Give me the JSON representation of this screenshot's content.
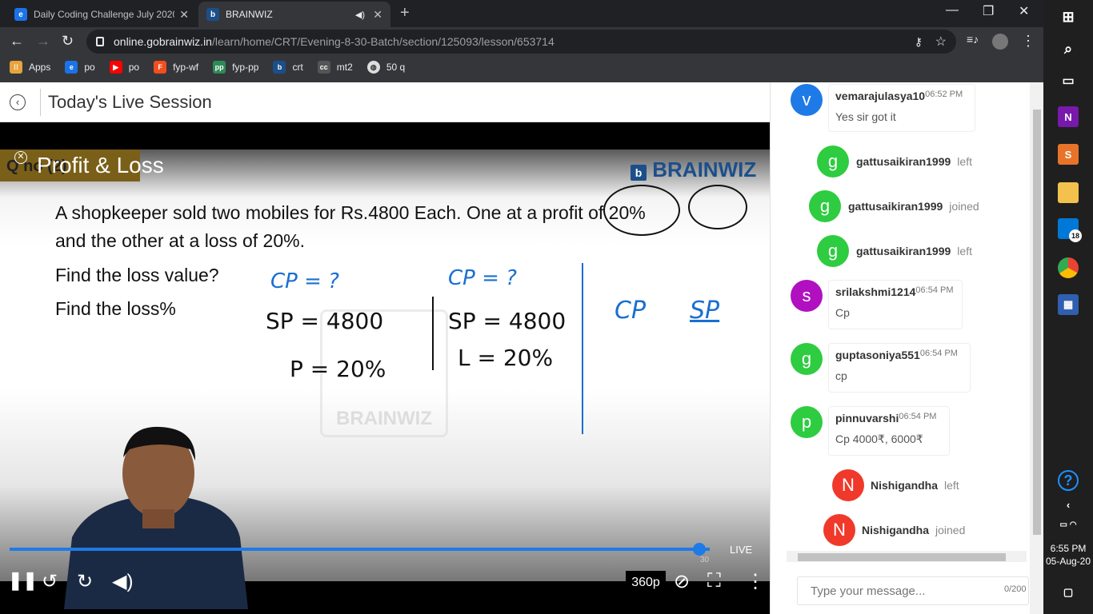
{
  "browser": {
    "tabs": [
      {
        "title": "Daily Coding Challenge July 2020",
        "favicon_color": "#1a73e8"
      },
      {
        "title": "BRAINWIZ",
        "favicon_color": "#1c4f8a"
      }
    ],
    "url_host": "online.gobrainwiz.in",
    "url_path": "/learn/home/CRT/Evening-8-30-Batch/section/125093/lesson/653714",
    "bookmarks": [
      {
        "label": "Apps",
        "icon": "apps-grid-icon",
        "color": "#e8a33d"
      },
      {
        "label": "po",
        "icon": "edge-icon",
        "color": "#1a73e8"
      },
      {
        "label": "po",
        "icon": "youtube-icon",
        "color": "#ff0000"
      },
      {
        "label": "fyp-wf",
        "icon": "figma-icon",
        "color": "#f24e1e"
      },
      {
        "label": "fyp-pp",
        "icon": "pp-icon",
        "color": "#2e8b57"
      },
      {
        "label": "crt",
        "icon": "brainwiz-icon",
        "color": "#1c4f8a"
      },
      {
        "label": "mt2",
        "icon": "cc-icon",
        "color": "#555555"
      },
      {
        "label": "50 q",
        "icon": "globe-icon",
        "color": "#dddddd"
      }
    ]
  },
  "header": {
    "title": "Today's Live Session"
  },
  "slide": {
    "tag": "Q no (2)",
    "title": "Profit & Loss",
    "brand": "BRAINWIZ",
    "watermark": "BRAINWIZ",
    "question_line1": "A shopkeeper sold two mobiles for Rs.4800 Each. One at a profit of 20%",
    "question_line2": "and the other at a loss of 20%.",
    "ask1": "Find the loss value?",
    "ask2": "Find the loss%",
    "ink": {
      "cp1": "CP = ?",
      "cp2": "CP = ?",
      "sp1": "SP = 4800",
      "sp2": "SP = 4800",
      "p": "P = 20%",
      "l": "L = 20%",
      "cp3": "CP",
      "sp3": "SP"
    }
  },
  "player": {
    "live_label": "LIVE",
    "live_offset": "30",
    "quality": "360p",
    "progress": 1.0
  },
  "chat": {
    "messages": [
      {
        "type": "msg",
        "initial": "v",
        "color": "#1e7ae6",
        "user": "vemarajulasya10",
        "time": "06:52 PM",
        "text": "Yes sir got it"
      },
      {
        "type": "sys",
        "initial": "g",
        "color": "#2ecc40",
        "user": "gattusaikiran1999",
        "event": "left"
      },
      {
        "type": "sys",
        "initial": "g",
        "color": "#2ecc40",
        "user": "gattusaikiran1999",
        "event": "joined"
      },
      {
        "type": "sys",
        "initial": "g",
        "color": "#2ecc40",
        "user": "gattusaikiran1999",
        "event": "left"
      },
      {
        "type": "msg",
        "initial": "s",
        "color": "#b010c0",
        "user": "srilakshmi1214",
        "time": "06:54 PM",
        "text": "Cp"
      },
      {
        "type": "msg",
        "initial": "g",
        "color": "#2ecc40",
        "user": "guptasoniya551",
        "time": "06:54 PM",
        "text": "cp"
      },
      {
        "type": "msg",
        "initial": "p",
        "color": "#2ecc40",
        "user": "pinnuvarshi",
        "time": "06:54 PM",
        "text": "Cp 4000₹, 6000₹"
      },
      {
        "type": "sys",
        "initial": "N",
        "color": "#f0392b",
        "user": "Nishigandha",
        "event": "left"
      },
      {
        "type": "sys",
        "initial": "N",
        "color": "#f0392b",
        "user": "Nishigandha",
        "event": "joined"
      }
    ],
    "input_placeholder": "Type your message...",
    "char_count": "0/200"
  },
  "taskbar": {
    "time": "6:55 PM",
    "date": "05-Aug-20",
    "badge": "18",
    "help": "?"
  }
}
